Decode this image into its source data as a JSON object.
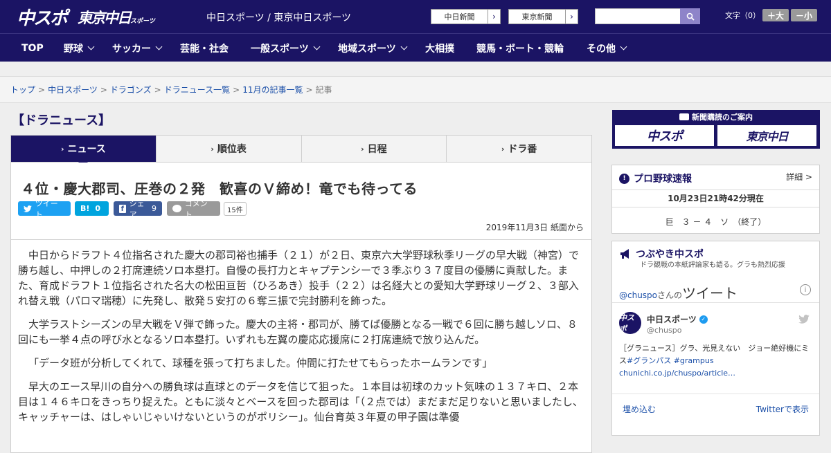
{
  "header": {
    "logo_chuspo": "中スポ",
    "logo_tokyo": "東京中日",
    "logo_tokyo_small": "スポーツ",
    "site_title": "中日スポーツ / 東京中日スポーツ",
    "paper_links": [
      "中日新聞",
      "東京新聞"
    ],
    "search_placeholder": "",
    "font_size_label": "文字（0）",
    "font_larger": "＋大",
    "font_smaller": "－小"
  },
  "nav": {
    "items": [
      {
        "label": "TOP"
      },
      {
        "label": "野球"
      },
      {
        "label": "サッカー"
      },
      {
        "label": "芸能・社会"
      },
      {
        "label": "一般スポーツ"
      },
      {
        "label": "地域スポーツ"
      },
      {
        "label": "大相撲"
      },
      {
        "label": "競馬・ボート・競輪"
      },
      {
        "label": "その他"
      }
    ]
  },
  "breadcrumb": {
    "items": [
      "トップ",
      "中日スポーツ",
      "ドラゴンズ",
      "ドラニュース一覧",
      "11月の記事一覧"
    ],
    "current": "記事",
    "separator": ">"
  },
  "section": {
    "title": "【ドラニュース】"
  },
  "tabs": [
    {
      "label": "ニュース"
    },
    {
      "label": "順位表"
    },
    {
      "label": "日程"
    },
    {
      "label": "ドラ番"
    }
  ],
  "article": {
    "headline": "４位・慶大郡司、圧巻の２発　歓喜のＶ締め！竜でも待ってる",
    "share": {
      "tweet": "ツイート",
      "hatena": "B!",
      "hatena_count": "0",
      "facebook": "シェア",
      "facebook_count": "9",
      "comment": "コメント",
      "comment_count": "15件"
    },
    "date": "2019年11月3日 紙面から",
    "paragraphs": [
      "中日からドラフト４位指名された慶大の郡司裕也捕手（２１）が２日、東京六大学野球秋季リーグの早大戦（神宮）で勝ち越し、中押しの２打席連続ソロ本塁打。自慢の長打力とキャプテンシーで３季ぶり３７度目の優勝に貢献した。また、育成ドラフト１位指名された名大の松田亘哲（ひろあき）投手（２２）は名経大との愛知大学野球リーグ２、３部入れ替え戦（パロマ瑞穂）に先発し、散発５安打の６奪三振で完封勝利を飾った。",
      "大学ラストシーズンの早大戦をＶ弾で飾った。慶大の主将・郡司が、勝てば優勝となる一戦で６回に勝ち越しソロ、８回にも一挙４点の呼び水となるソロ本塁打。いずれも左翼の慶応応援席に２打席連続で放り込んだ。",
      "「データ班が分析してくれて、球種を張って打ちました。仲間に打たせてもらったホームランです」",
      "早大のエース早川の自分への勝負球は直球とのデータを信じて狙った。１本目は初球のカット気味の１３７キロ、２本目は１４６キロをきっちり捉えた。ともに淡々とベースを回った郡司は「（２点では）まだまだ足りないと思いましたし、キャッチャーは、はしゃいじゃいけないというのがポリシー」。仙台育英３年夏の甲子園は準優"
    ]
  },
  "sidebar": {
    "subscribe": {
      "heading": "新聞購読のご案内",
      "btn_chuspo": "中スポ",
      "btn_tokyo": "東京中日"
    },
    "baseball": {
      "title": "プロ野球速報",
      "detail": "詳細 >",
      "time": "10月23日21時42分現在",
      "score": "巨　３ － ４　ソ　（終了）"
    },
    "twitter": {
      "title": "つぶやき中スポ",
      "subtitle": "ドラ観戦の本紙評論家も語る。グラも熱烈応援",
      "handle": "@chuspo",
      "handle_suffix": "さんの",
      "tweets_word": "ツイート",
      "account_name": "中日スポーツ",
      "screen_name": "@chuspo",
      "tweet_text": "［グラニュース］グラ、光見えない　ジョー絶好機にミス",
      "tweet_hash": "#グランパス #grampus",
      "tweet_link": "chunichi.co.jp/chuspo/article…",
      "embed": "埋め込む",
      "view_on": "Twitterで表示"
    }
  },
  "colors": {
    "brand": "#1b1464",
    "twitter": "#1da1f2",
    "facebook": "#3b5998",
    "hatena": "#00a4de"
  }
}
